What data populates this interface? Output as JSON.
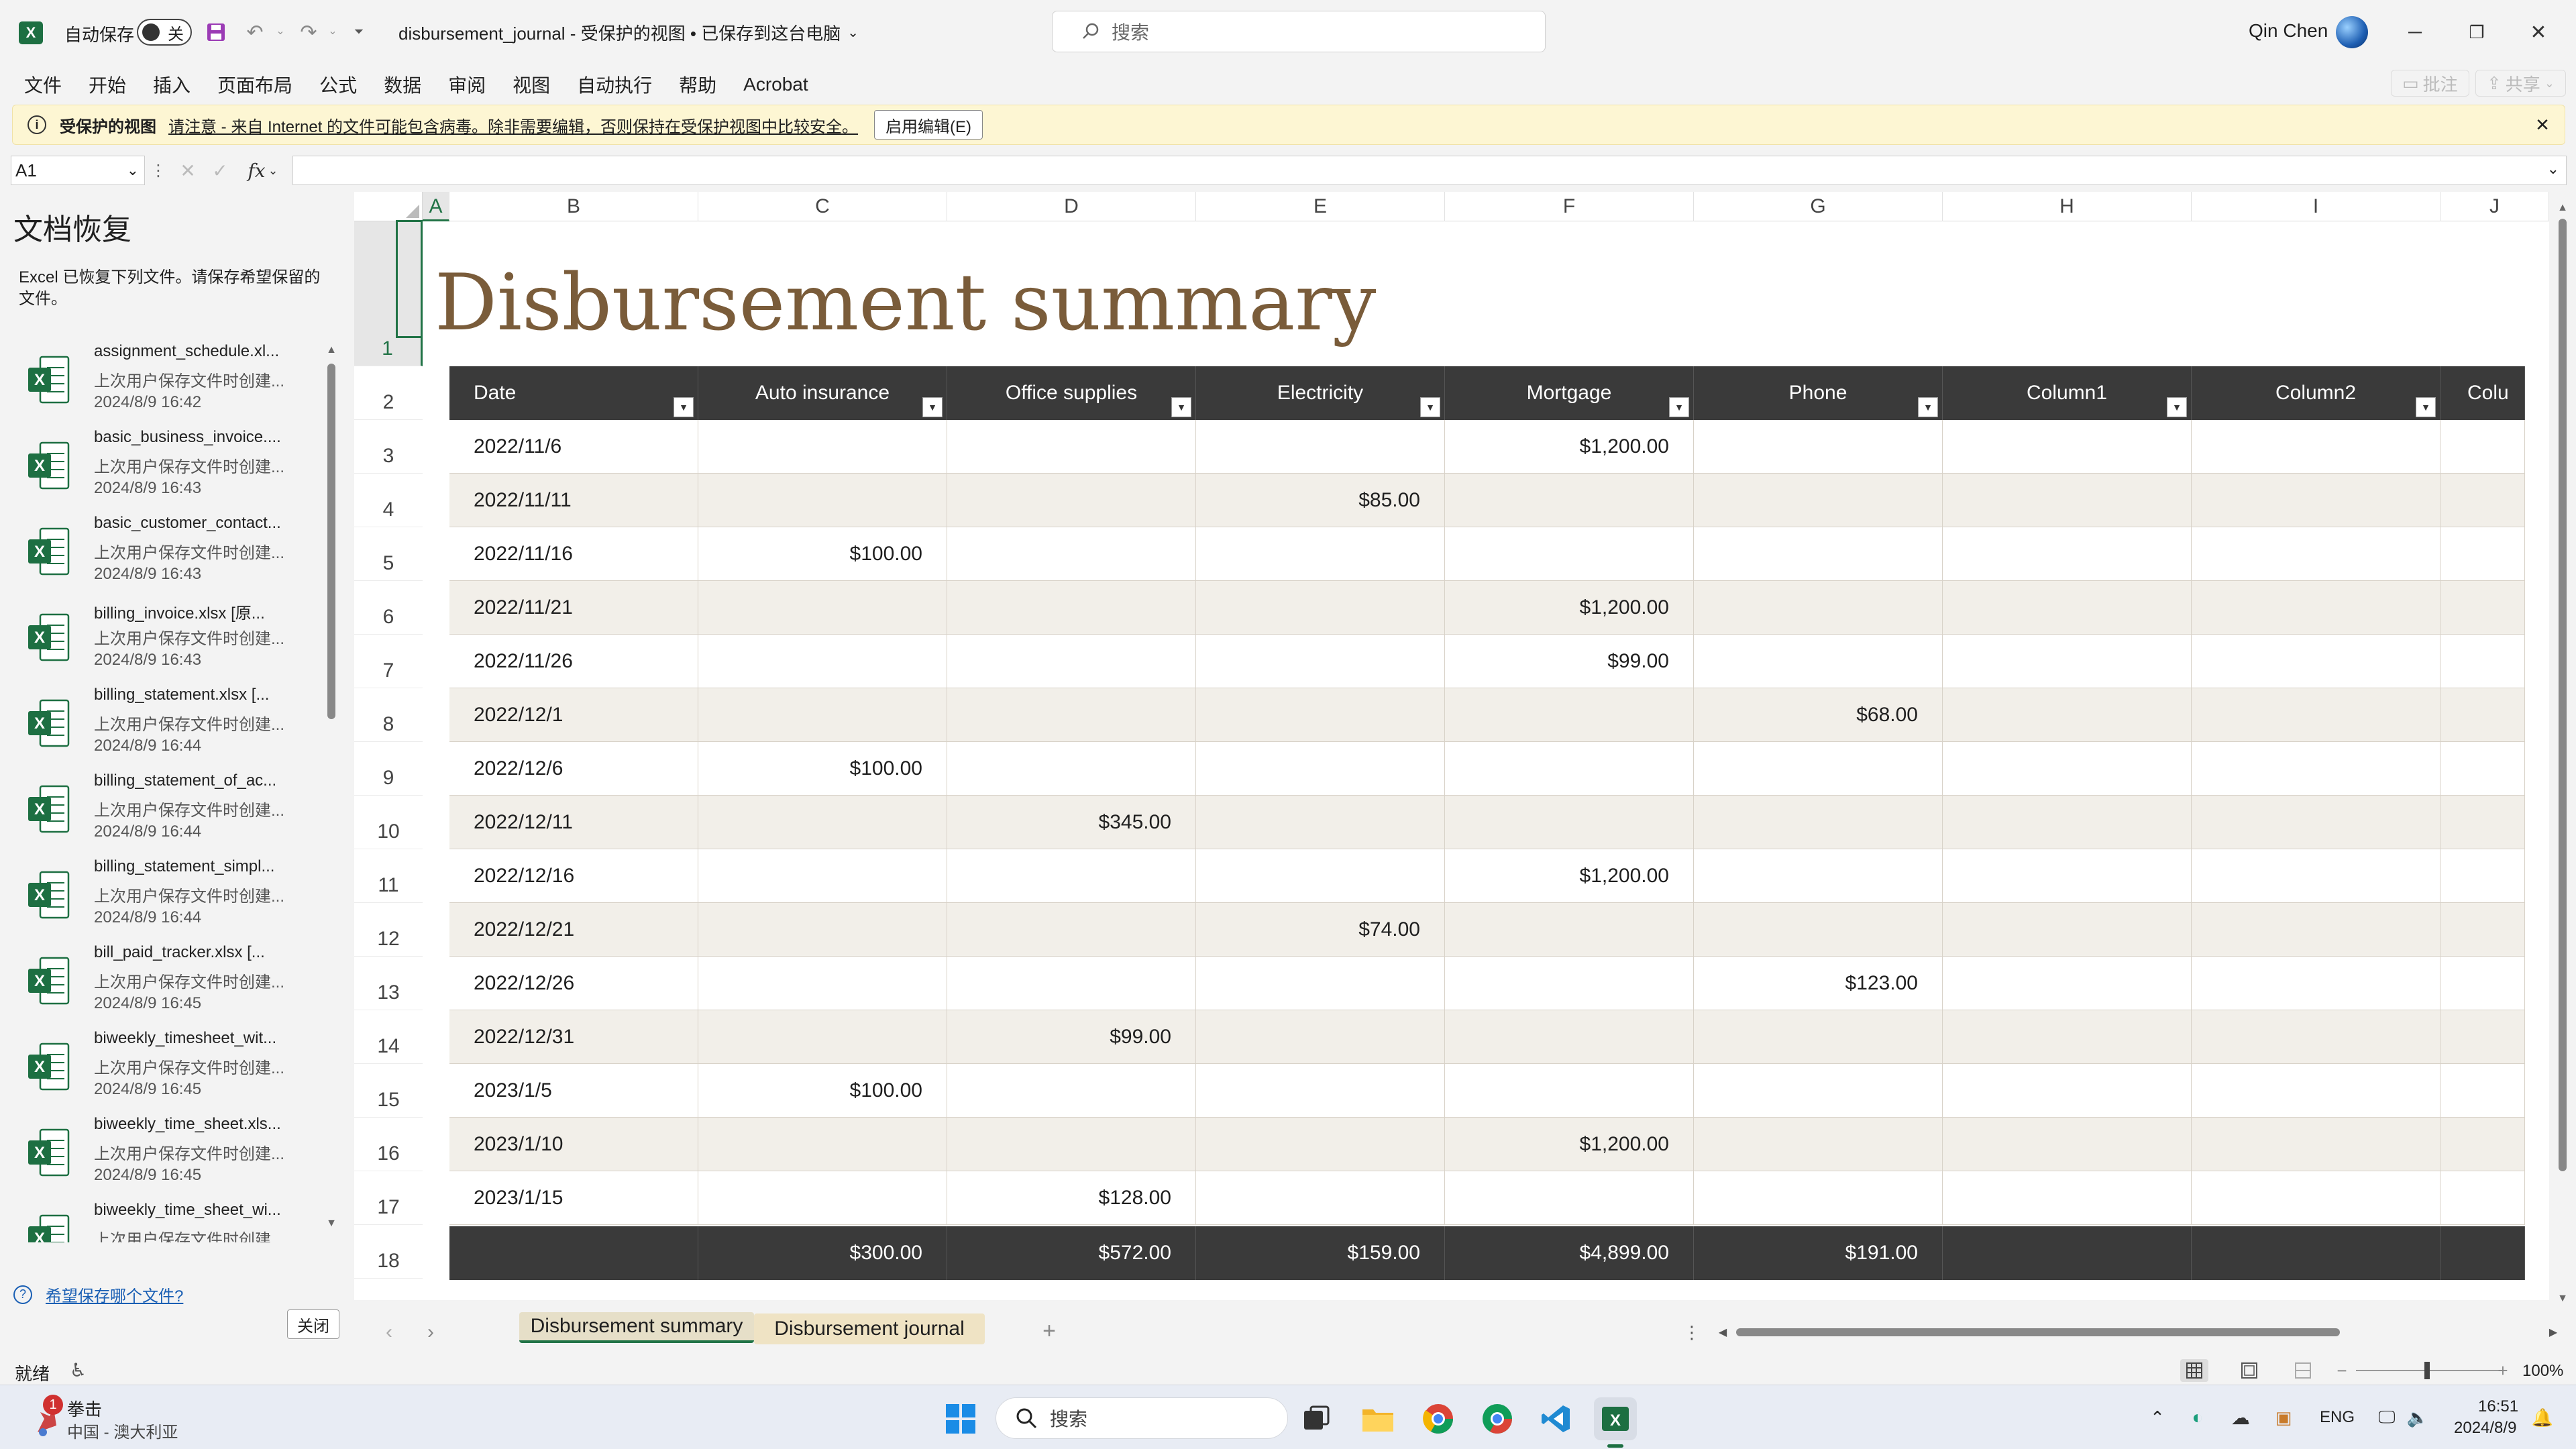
{
  "titlebar": {
    "autosave_label": "自动保存",
    "autosave_state": "关",
    "doc_title": "disbursement_journal  -  受保护的视图 • 已保存到这台电脑",
    "search_placeholder": "搜索",
    "user_name": "Qin Chen"
  },
  "menu": [
    "文件",
    "开始",
    "插入",
    "页面布局",
    "公式",
    "数据",
    "审阅",
    "视图",
    "自动执行",
    "帮助",
    "Acrobat"
  ],
  "ribbon_right": {
    "comments": "批注",
    "share": "共享"
  },
  "infobar": {
    "title": "受保护的视图",
    "message": "请注意 - 来自 Internet 的文件可能包含病毒。除非需要编辑，否则保持在受保护视图中比较安全。",
    "button": "启用编辑(E)"
  },
  "formula": {
    "namebox": "A1",
    "fx": "fx",
    "value": ""
  },
  "recovery": {
    "title": "文档恢复",
    "description": "Excel 已恢复下列文件。请保存希望保留的文件。",
    "items": [
      {
        "name": "assignment_schedule.xl...",
        "desc": "上次用户保存文件时创建...",
        "date": "2024/8/9 16:42"
      },
      {
        "name": "basic_business_invoice....",
        "desc": "上次用户保存文件时创建...",
        "date": "2024/8/9 16:43"
      },
      {
        "name": "basic_customer_contact...",
        "desc": "上次用户保存文件时创建...",
        "date": "2024/8/9 16:43"
      },
      {
        "name": "billing_invoice.xlsx  [原...",
        "desc": "上次用户保存文件时创建...",
        "date": "2024/8/9 16:43"
      },
      {
        "name": "billing_statement.xlsx  [...",
        "desc": "上次用户保存文件时创建...",
        "date": "2024/8/9 16:44"
      },
      {
        "name": "billing_statement_of_ac...",
        "desc": "上次用户保存文件时创建...",
        "date": "2024/8/9 16:44"
      },
      {
        "name": "billing_statement_simpl...",
        "desc": "上次用户保存文件时创建...",
        "date": "2024/8/9 16:44"
      },
      {
        "name": "bill_paid_tracker.xlsx  [...",
        "desc": "上次用户保存文件时创建...",
        "date": "2024/8/9 16:45"
      },
      {
        "name": "biweekly_timesheet_wit...",
        "desc": "上次用户保存文件时创建...",
        "date": "2024/8/9 16:45"
      },
      {
        "name": "biweekly_time_sheet.xls...",
        "desc": "上次用户保存文件时创建...",
        "date": "2024/8/9 16:45"
      },
      {
        "name": "biweekly_time_sheet_wi...",
        "desc": "上次用户保存文件时创建...",
        "date": ""
      }
    ],
    "help_link": "希望保存哪个文件?",
    "close_button": "关闭"
  },
  "sheet": {
    "columns": [
      "A",
      "B",
      "C",
      "D",
      "E",
      "F",
      "G",
      "H",
      "I",
      "J"
    ],
    "rows": [
      "1",
      "2",
      "3",
      "4",
      "5",
      "6",
      "7",
      "8",
      "9",
      "10",
      "11",
      "12",
      "13",
      "14",
      "15",
      "16",
      "17",
      "18"
    ],
    "title": "Disbursement summary",
    "headers": [
      "Date",
      "Auto insurance",
      "Office supplies",
      "Electricity",
      "Mortgage",
      "Phone",
      "Column1",
      "Column2",
      "Colu"
    ],
    "data": [
      [
        "2022/11/6",
        "",
        "",
        "",
        "$1,200.00",
        "",
        "",
        ""
      ],
      [
        "2022/11/11",
        "",
        "",
        "$85.00",
        "",
        "",
        "",
        ""
      ],
      [
        "2022/11/16",
        "$100.00",
        "",
        "",
        "",
        "",
        "",
        ""
      ],
      [
        "2022/11/21",
        "",
        "",
        "",
        "$1,200.00",
        "",
        "",
        ""
      ],
      [
        "2022/11/26",
        "",
        "",
        "",
        "$99.00",
        "",
        "",
        ""
      ],
      [
        "2022/12/1",
        "",
        "",
        "",
        "",
        "$68.00",
        "",
        ""
      ],
      [
        "2022/12/6",
        "$100.00",
        "",
        "",
        "",
        "",
        "",
        ""
      ],
      [
        "2022/12/11",
        "",
        "$345.00",
        "",
        "",
        "",
        "",
        ""
      ],
      [
        "2022/12/16",
        "",
        "",
        "",
        "$1,200.00",
        "",
        "",
        ""
      ],
      [
        "2022/12/21",
        "",
        "",
        "$74.00",
        "",
        "",
        "",
        ""
      ],
      [
        "2022/12/26",
        "",
        "",
        "",
        "",
        "$123.00",
        "",
        ""
      ],
      [
        "2022/12/31",
        "",
        "$99.00",
        "",
        "",
        "",
        "",
        ""
      ],
      [
        "2023/1/5",
        "$100.00",
        "",
        "",
        "",
        "",
        "",
        ""
      ],
      [
        "2023/1/10",
        "",
        "",
        "",
        "$1,200.00",
        "",
        "",
        ""
      ],
      [
        "2023/1/15",
        "",
        "$128.00",
        "",
        "",
        "",
        "",
        ""
      ]
    ],
    "totals": [
      "",
      "$300.00",
      "$572.00",
      "$159.00",
      "$4,899.00",
      "$191.00",
      "",
      ""
    ]
  },
  "tabs": {
    "active": "Disbursement summary",
    "other": "Disbursement journal"
  },
  "status": {
    "ready": "就绪",
    "zoom": "100%"
  },
  "taskbar": {
    "weather_title": "拳击",
    "weather_sub": "中国 - 澳大利亚",
    "weather_badge": "1",
    "search_placeholder": "搜索",
    "lang": "ENG",
    "time": "16:51",
    "date": "2024/8/9"
  },
  "colors": {
    "accent": "#217346",
    "header_dark": "#3a3a3a",
    "title_brown": "#7a5c3a",
    "stripe": "#f2efe9"
  }
}
